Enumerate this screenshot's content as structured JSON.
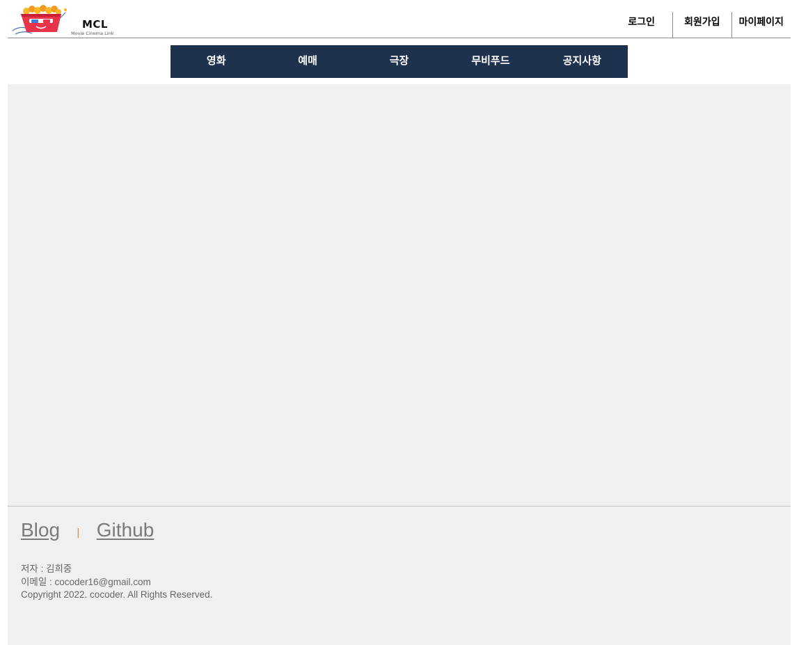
{
  "header": {
    "logo_title": "MCL",
    "logo_subtitle": "Movie Cinema Link",
    "links": [
      "로그인",
      "회원가입",
      "마이페이지"
    ]
  },
  "main_nav": {
    "items": [
      "영화",
      "예매",
      "극장",
      "무비푸드",
      "공지사항"
    ]
  },
  "footer": {
    "blog_label": "Blog",
    "separator": "|",
    "github_label": "Github",
    "author": "저자 : 김희중",
    "email": "이메일 : cocoder16@gmail.com",
    "copyright": "Copyright 2022. cocoder. All Rights Reserved."
  },
  "colors": {
    "nav_bg": "#1e314d",
    "content_bg": "#f0f0f0",
    "footer_link": "#7a7a7a",
    "logo_red": "#e8334a"
  },
  "icons": {
    "logo": "popcorn-3d-glasses-icon"
  }
}
